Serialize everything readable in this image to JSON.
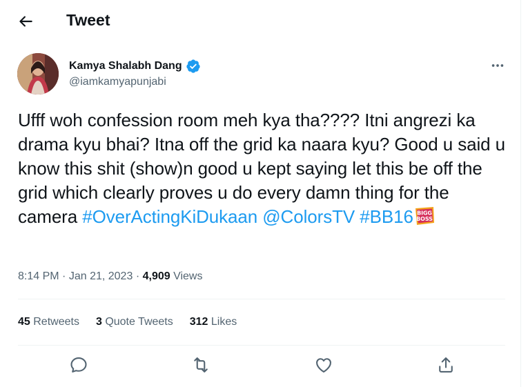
{
  "header": {
    "title": "Tweet"
  },
  "author": {
    "name": "Kamya Shalabh Dang",
    "handle": "@iamkamyapunjabi",
    "verified": true
  },
  "tweet": {
    "text": "Ufff woh confession room meh kya tha???? Itni angrezi ka drama kyu bhai? Itna off the grid ka naara kyu? Good u said u know this shit (show)n good u kept saying let this be off the grid which clearly proves u do every damn thing for the camera ",
    "hashtag1": "#OverActingKiDukaan",
    "mention": "@ColorsTV",
    "hashtag2": "#BB16",
    "emoji_text_top": "BIGG",
    "emoji_text_bottom": "BOSS"
  },
  "meta": {
    "time": "8:14 PM",
    "separator": "·",
    "date": "Jan 21, 2023",
    "views_count": "4,909",
    "views_label": "Views"
  },
  "stats": {
    "retweets_count": "45",
    "retweets_label": "Retweets",
    "quotes_count": "3",
    "quotes_label": "Quote Tweets",
    "likes_count": "312",
    "likes_label": "Likes"
  },
  "colors": {
    "link": "#1d9bf0",
    "secondary": "#536471",
    "divider": "#eff3f4"
  },
  "icons": [
    "back-arrow-icon",
    "verified-badge-icon",
    "more-icon",
    "reply-icon",
    "retweet-icon",
    "like-icon",
    "share-icon"
  ]
}
